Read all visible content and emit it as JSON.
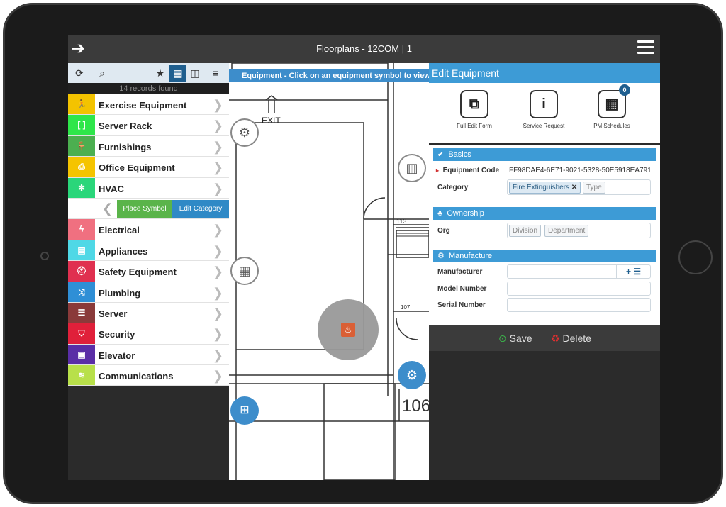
{
  "header": {
    "title": "Floorplans - 12COM | 1",
    "back_icon": "arrow-left-icon",
    "menu_icon": "hamburger-icon"
  },
  "toolbar": {
    "icons": [
      "refresh-icon",
      "search-icon",
      "star-icon",
      "grid-icon",
      "split-view-icon",
      "list-icon"
    ]
  },
  "records_text": "14 records found",
  "categories": [
    {
      "label": "Exercise Equipment",
      "color": "#f3c300",
      "glyph": "🏃"
    },
    {
      "label": "Server Rack",
      "color": "#2ee64a",
      "glyph": "[ ]"
    },
    {
      "label": "Furnishings",
      "color": "#4caf50",
      "glyph": "🪑"
    },
    {
      "label": "Office Equipment",
      "color": "#f5c400",
      "glyph": "⎙"
    },
    {
      "label": "HVAC",
      "color": "#2ad67a",
      "glyph": "✻"
    },
    {
      "label": "Electrical",
      "color": "#f07080",
      "glyph": "ϟ"
    },
    {
      "label": "Appliances",
      "color": "#4fd8e6",
      "glyph": "▤"
    },
    {
      "label": "Safety Equipment",
      "color": "#e03050",
      "glyph": "⛑"
    },
    {
      "label": "Plumbing",
      "color": "#2f8fd6",
      "glyph": "⤨"
    },
    {
      "label": "Server",
      "color": "#8a3a3a",
      "glyph": "☰"
    },
    {
      "label": "Security",
      "color": "#e0203a",
      "glyph": "⛉"
    },
    {
      "label": "Elevator",
      "color": "#5a2ea6",
      "glyph": "▣"
    },
    {
      "label": "Communications",
      "color": "#b8e04a",
      "glyph": "≋"
    }
  ],
  "actions": {
    "place_symbol": "Place Symbol",
    "edit_category": "Edit Category"
  },
  "floor": {
    "banner": "Equipment - Click on an equipment symbol to view",
    "exit_label": "EXIT",
    "room_113": "113",
    "room_107": "107",
    "room_106": "106"
  },
  "panel": {
    "title": "Edit Equipment",
    "quick_actions": [
      {
        "label": "Full Edit Form",
        "icon": "external-link-icon"
      },
      {
        "label": "Service Request",
        "icon": "info-icon"
      },
      {
        "label": "PM Schedules",
        "icon": "calendar-icon",
        "badge": "0"
      }
    ],
    "basics": {
      "title": "Basics",
      "equipment_code_label": "Equipment Code",
      "equipment_code_value": "FF98DAE4-6E71-9021-5328-50E5918EA791",
      "category_label": "Category",
      "category_chip": "Fire Extinguishers",
      "type_placeholder": "Type"
    },
    "ownership": {
      "title": "Ownership",
      "org_label": "Org",
      "division_placeholder": "Division",
      "department_placeholder": "Department"
    },
    "manufacture": {
      "title": "Manufacture",
      "manufacturer_label": "Manufacturer",
      "model_label": "Model Number",
      "serial_label": "Serial Number"
    },
    "save_label": "Save",
    "delete_label": "Delete"
  }
}
